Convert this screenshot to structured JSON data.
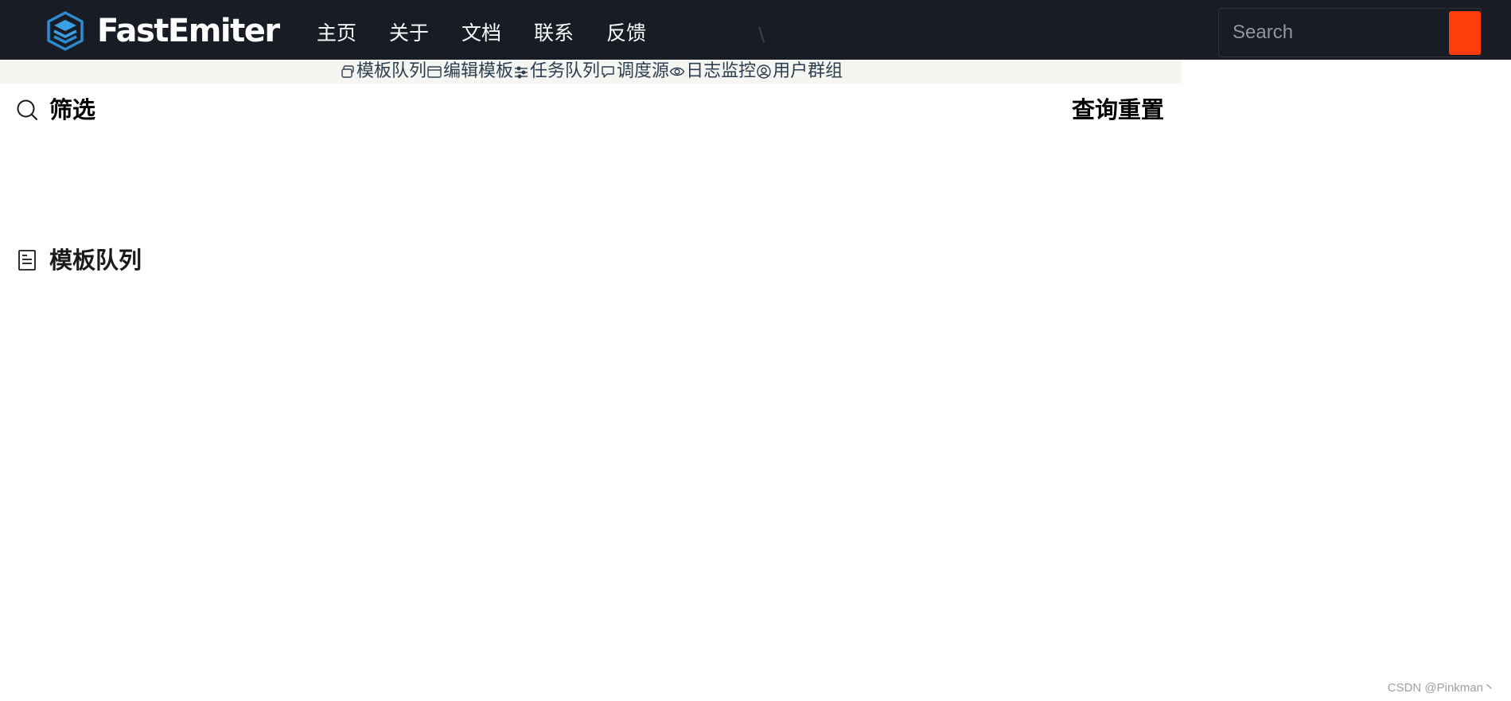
{
  "header": {
    "brand_name": "FastEmiter",
    "nav": [
      "主页",
      "关于",
      "文档",
      "联系",
      "反馈"
    ],
    "separator": "\\",
    "search": {
      "placeholder": "Search"
    },
    "accent_color": "#ff3d0a",
    "background_color": "#181c24"
  },
  "subnav": {
    "items": [
      {
        "label": "模板队列",
        "icon": "stack-icon"
      },
      {
        "label": "编辑模板",
        "icon": "window-icon"
      },
      {
        "label": "任务队列",
        "icon": "sliders-icon"
      },
      {
        "label": "调度源",
        "icon": "chat-icon"
      },
      {
        "label": "日志监控",
        "icon": "eye-icon"
      },
      {
        "label": "用户群组",
        "icon": "user-circle-icon"
      }
    ]
  },
  "filter": {
    "title": "筛选",
    "icon": "search-icon",
    "query_label": "查询",
    "reset_label": "重置"
  },
  "queue": {
    "title": "模板队列",
    "icon": "document-icon"
  },
  "watermark": "CSDN @Pinkman丶"
}
